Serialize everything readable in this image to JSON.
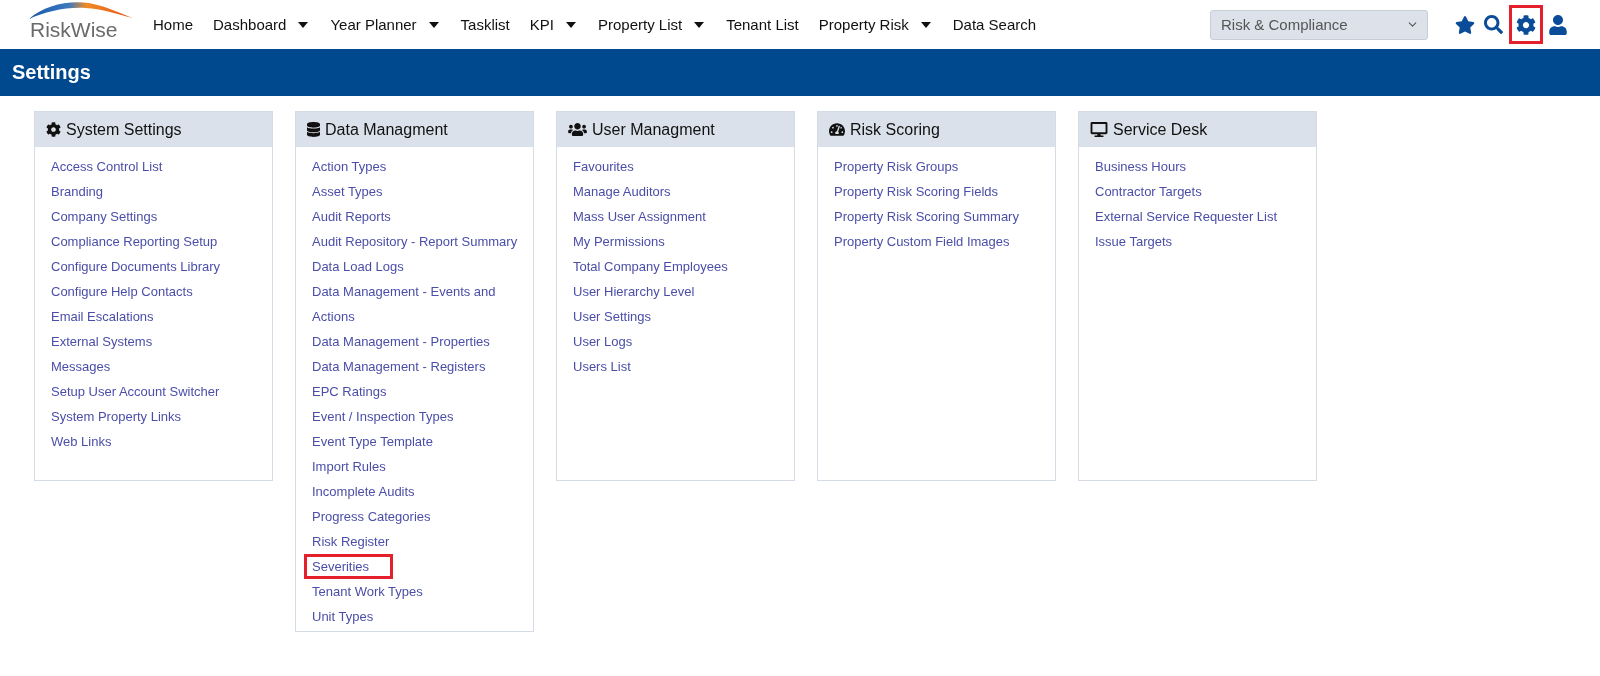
{
  "header": {
    "logo": {
      "text": "RiskWise"
    },
    "nav": [
      {
        "label": "Home",
        "dropdown": false
      },
      {
        "label": "Dashboard",
        "dropdown": true
      },
      {
        "label": "Year Planner",
        "dropdown": true
      },
      {
        "label": "Tasklist",
        "dropdown": false
      },
      {
        "label": "KPI",
        "dropdown": true
      },
      {
        "label": "Property List",
        "dropdown": true
      },
      {
        "label": "Tenant List",
        "dropdown": false
      },
      {
        "label": "Property Risk",
        "dropdown": true
      },
      {
        "label": "Data Search",
        "dropdown": false
      }
    ],
    "module_select": {
      "value": "Risk & Compliance"
    },
    "actions": [
      {
        "kind": "favourites",
        "highlighted": false
      },
      {
        "kind": "search",
        "highlighted": false
      },
      {
        "kind": "settings",
        "highlighted": true
      },
      {
        "kind": "account",
        "highlighted": false
      }
    ]
  },
  "page_title": "Settings",
  "panels": [
    {
      "kind": "gear",
      "title": "System Settings",
      "links": [
        {
          "label": "Access Control List",
          "highlighted": false
        },
        {
          "label": "Branding",
          "highlighted": false
        },
        {
          "label": "Company Settings",
          "highlighted": false
        },
        {
          "label": "Compliance Reporting Setup",
          "highlighted": false
        },
        {
          "label": "Configure Documents Library",
          "highlighted": false
        },
        {
          "label": "Configure Help Contacts",
          "highlighted": false
        },
        {
          "label": "Email Escalations",
          "highlighted": false
        },
        {
          "label": "External Systems",
          "highlighted": false
        },
        {
          "label": "Messages",
          "highlighted": false
        },
        {
          "label": "Setup User Account Switcher",
          "highlighted": false
        },
        {
          "label": "System Property Links",
          "highlighted": false
        },
        {
          "label": "Web Links",
          "highlighted": false
        }
      ]
    },
    {
      "kind": "database",
      "title": "Data Managment",
      "links": [
        {
          "label": "Action Types",
          "highlighted": false
        },
        {
          "label": "Asset Types",
          "highlighted": false
        },
        {
          "label": "Audit Reports",
          "highlighted": false
        },
        {
          "label": "Audit Repository - Report Summary",
          "highlighted": false
        },
        {
          "label": "Data Load Logs",
          "highlighted": false
        },
        {
          "label": "Data Management - Events and Actions",
          "highlighted": false
        },
        {
          "label": "Data Management - Properties",
          "highlighted": false
        },
        {
          "label": "Data Management - Registers",
          "highlighted": false
        },
        {
          "label": "EPC Ratings",
          "highlighted": false
        },
        {
          "label": "Event / Inspection Types",
          "highlighted": false
        },
        {
          "label": "Event Type Template",
          "highlighted": false
        },
        {
          "label": "Import Rules",
          "highlighted": false
        },
        {
          "label": "Incomplete Audits",
          "highlighted": false
        },
        {
          "label": "Progress Categories",
          "highlighted": false
        },
        {
          "label": "Risk Register",
          "highlighted": false
        },
        {
          "label": "Severities",
          "highlighted": true
        },
        {
          "label": "Tenant Work Types",
          "highlighted": false
        },
        {
          "label": "Unit Types",
          "highlighted": false
        }
      ]
    },
    {
      "kind": "users",
      "title": "User Managment",
      "links": [
        {
          "label": "Favourites",
          "highlighted": false
        },
        {
          "label": "Manage Auditors",
          "highlighted": false
        },
        {
          "label": "Mass User Assignment",
          "highlighted": false
        },
        {
          "label": "My Permissions",
          "highlighted": false
        },
        {
          "label": "Total Company Employees",
          "highlighted": false
        },
        {
          "label": "User Hierarchy Level",
          "highlighted": false
        },
        {
          "label": "User Settings",
          "highlighted": false
        },
        {
          "label": "User Logs",
          "highlighted": false
        },
        {
          "label": "Users List",
          "highlighted": false
        }
      ]
    },
    {
      "kind": "gauge",
      "title": "Risk Scoring",
      "links": [
        {
          "label": "Property Risk Groups",
          "highlighted": false
        },
        {
          "label": "Property Risk Scoring Fields",
          "highlighted": false
        },
        {
          "label": "Property Risk Scoring Summary",
          "highlighted": false
        },
        {
          "label": "Property Custom Field Images",
          "highlighted": false
        }
      ]
    },
    {
      "kind": "desktop",
      "title": "Service Desk",
      "links": [
        {
          "label": "Business Hours",
          "highlighted": false
        },
        {
          "label": "Contractor Targets",
          "highlighted": false
        },
        {
          "label": "External Service Requester List",
          "highlighted": false
        },
        {
          "label": "Issue Targets",
          "highlighted": false
        }
      ]
    }
  ]
}
